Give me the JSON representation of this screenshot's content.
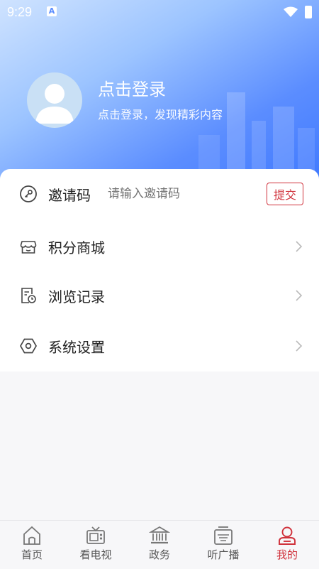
{
  "status_bar": {
    "time": "9:29",
    "app_icon": "A"
  },
  "profile": {
    "title": "点击登录",
    "subtitle": "点击登录，发现精彩内容"
  },
  "menu": {
    "invite": {
      "label": "邀请码",
      "placeholder": "请输入邀请码",
      "submit_label": "提交"
    },
    "items": [
      {
        "label": "积分商城",
        "icon": "store-icon"
      },
      {
        "label": "浏览记录",
        "icon": "history-icon"
      },
      {
        "label": "系统设置",
        "icon": "settings-icon"
      }
    ]
  },
  "tabbar": {
    "tabs": [
      {
        "label": "首页",
        "icon": "home-icon"
      },
      {
        "label": "看电视",
        "icon": "tv-icon"
      },
      {
        "label": "政务",
        "icon": "government-icon"
      },
      {
        "label": "听广播",
        "icon": "radio-icon"
      },
      {
        "label": "我的",
        "icon": "user-icon"
      }
    ],
    "active": "我的"
  },
  "colors": {
    "accent": "#d0313b",
    "header_blue": "#5b8dff",
    "icon_gray": "#555555"
  }
}
